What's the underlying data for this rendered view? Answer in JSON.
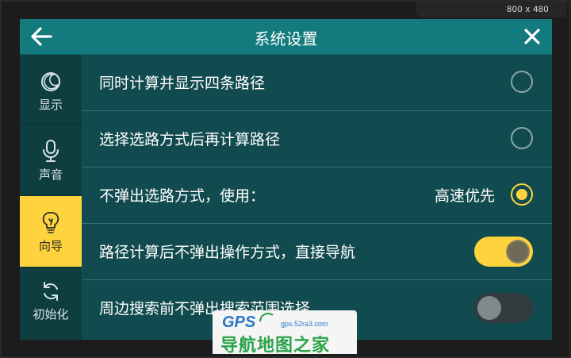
{
  "resolution_label": "800 x 480",
  "header": {
    "title": "系统设置",
    "back_icon": "back-arrow-icon",
    "close_icon": "close-icon"
  },
  "sidebar": {
    "items": [
      {
        "label": "显示",
        "icon": "moon-icon",
        "active": false
      },
      {
        "label": "声音",
        "icon": "microphone-icon",
        "active": false
      },
      {
        "label": "向导",
        "icon": "lightbulb-icon",
        "active": true
      },
      {
        "label": "初始化",
        "icon": "refresh-icon",
        "active": false
      }
    ]
  },
  "settings": {
    "rows": [
      {
        "label": "同时计算并显示四条路径",
        "control": "radio",
        "checked": false
      },
      {
        "label": "选择选路方式后再计算路径",
        "control": "radio",
        "checked": false
      },
      {
        "label": "不弹出选路方式，使用：",
        "value": "高速优先",
        "control": "radio",
        "checked": true
      },
      {
        "label": "路径计算后不弹出操作方式，直接导航",
        "control": "toggle",
        "checked": true
      },
      {
        "label": "周边搜索前不弹出搜索范围选择",
        "control": "toggle",
        "checked": false
      }
    ]
  },
  "watermark": {
    "brand": "GPS",
    "url": "gps.52ra3.com",
    "name": "导航地图之家"
  },
  "colors": {
    "accent": "#ffd33d",
    "header": "#137a7d",
    "panel": "#124b4f",
    "sidebar": "#0f3e41"
  }
}
